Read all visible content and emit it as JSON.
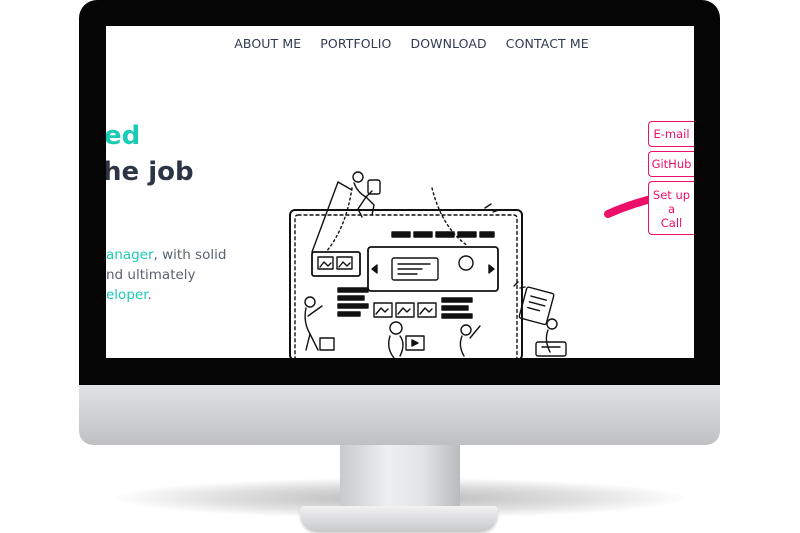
{
  "nav": {
    "items": [
      {
        "label": "ABOUT ME"
      },
      {
        "label": "PORTFOLIO"
      },
      {
        "label": "DOWNLOAD"
      },
      {
        "label": "CONTACT ME"
      }
    ]
  },
  "hero": {
    "line1": "ed",
    "line2": "he job",
    "desc_part1": "anager",
    "desc_part2": ", with solid",
    "desc_part3": "nd ultimately",
    "desc_part4": "eloper",
    "desc_part5": "."
  },
  "side_buttons": {
    "email": "E-mail",
    "github": "GitHub",
    "call_line1": "Set up a",
    "call_line2": "Call"
  },
  "colors": {
    "accent_teal": "#1ccbb6",
    "accent_pink": "#ec0f6a",
    "nav_text": "#2f3b52"
  },
  "icons": [
    "arrow-icon",
    "web-design-illustration"
  ]
}
